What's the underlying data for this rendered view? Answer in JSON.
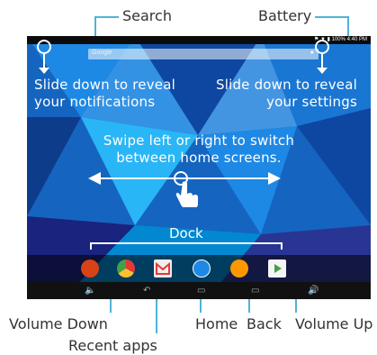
{
  "callouts": {
    "search": "Search",
    "battery": "Battery",
    "volume_down": "Volume Down",
    "recent_apps": "Recent apps",
    "home": "Home",
    "back": "Back",
    "volume_up": "Volume Up"
  },
  "hints": {
    "notifications": "Slide down to reveal\nyour notifications",
    "settings": "Slide down to reveal\nyour settings",
    "swipe": "Swipe left or right to switch\nbetween home screens.",
    "dock": "Dock"
  },
  "search_bar": {
    "placeholder": "Google",
    "mic_icon": "mic-icon"
  },
  "status_bar": {
    "text": "⚑ ▼ ▮ 100% 4:40 PM"
  },
  "dock_apps": [
    {
      "name": "app-1",
      "color": "#d84315"
    },
    {
      "name": "chrome",
      "color": "#fbc02d"
    },
    {
      "name": "gmail",
      "color": "#e53935"
    },
    {
      "name": "app-drawer",
      "color": "#1e88e5"
    },
    {
      "name": "play-music",
      "color": "#ff9800"
    },
    {
      "name": "play-store",
      "color": "#eeeeee"
    }
  ],
  "colors": {
    "callout_line": "#4fb3d9",
    "screen_blue": "#1565c0"
  }
}
